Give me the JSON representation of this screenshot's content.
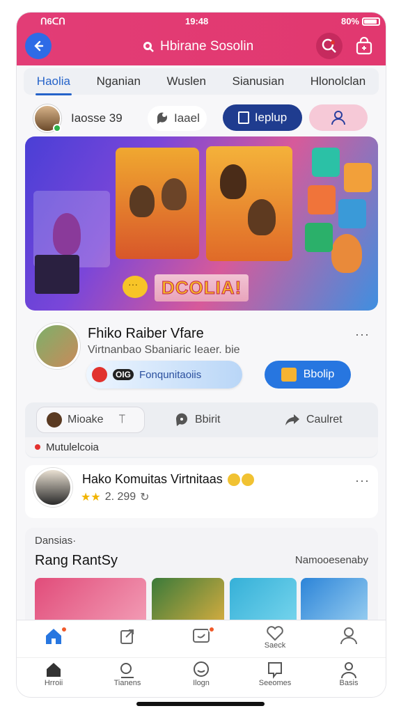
{
  "status": {
    "time_left": "ᑎ6ᑕᑎ",
    "time": "19:48",
    "battery": "80%",
    "battery_level": 0.8
  },
  "header": {
    "title": "Hbirane Sosolin",
    "colors": {
      "bar": "#e23d76",
      "back": "#2e6be6"
    }
  },
  "tabs": [
    "Haolia",
    "Nganian",
    "Wuslen",
    "Sianusian",
    "Hlonolclan"
  ],
  "userbar": {
    "username": "Iaosse 39",
    "label": "Iaael",
    "primary": "Ieplup"
  },
  "banner": {
    "title": "DCOLIA!"
  },
  "post1": {
    "title": "Fhiko Raiber Vfare",
    "subtitle": "Virtnanbao Sbaniaric Ieaer. bie",
    "comm_chip": "OIG",
    "comm_label": "Fonqunitaoiis",
    "action_label": "Bbolip"
  },
  "actions": {
    "miake": "Mioake",
    "bbirit": "Bbirit",
    "caulret": "Caulret",
    "live": "Mutulelcoia"
  },
  "post2": {
    "title": "Hako Komuitas Virtnitaas",
    "rating": "2. 299"
  },
  "feed": {
    "label": "Dansias·",
    "title": "Rang RantSy",
    "link": "Namooesenaby"
  },
  "nav": {
    "top": [
      "",
      "",
      "",
      "Saeck",
      ""
    ],
    "bottom": [
      "Hrroii",
      "Tianens",
      "Ilogn",
      "Seeomes",
      "Basis"
    ]
  },
  "icons": [
    "back-icon",
    "search-icon",
    "bag-icon",
    "user-icon",
    "chat-icon",
    "home-icon",
    "share-icon",
    "heart-icon",
    "profile-icon"
  ]
}
